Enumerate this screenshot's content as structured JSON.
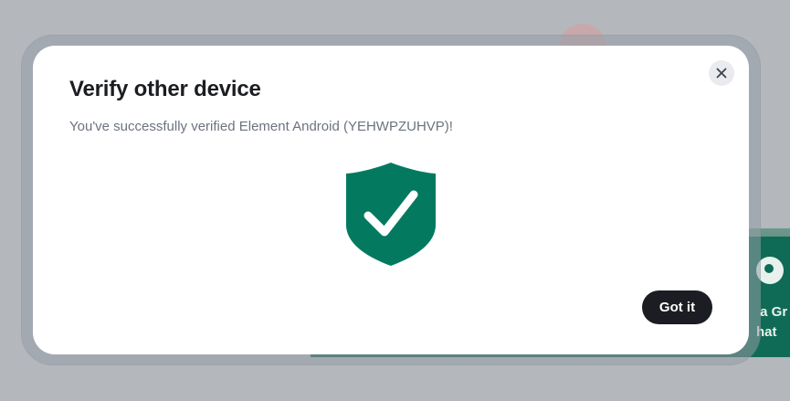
{
  "background": {
    "card_text": " a Gr\nhat"
  },
  "dialog": {
    "title": "Verify other device",
    "message": "You've successfully verified Element Android (YEHWPZUHVP)!",
    "confirm_label": "Got it",
    "close_icon": "close-icon",
    "status_icon": "shield-check-icon"
  },
  "colors": {
    "shield": "#037a5f",
    "button": "#1b1d22",
    "title": "#1b1d22",
    "subtitle": "#6c737e"
  }
}
